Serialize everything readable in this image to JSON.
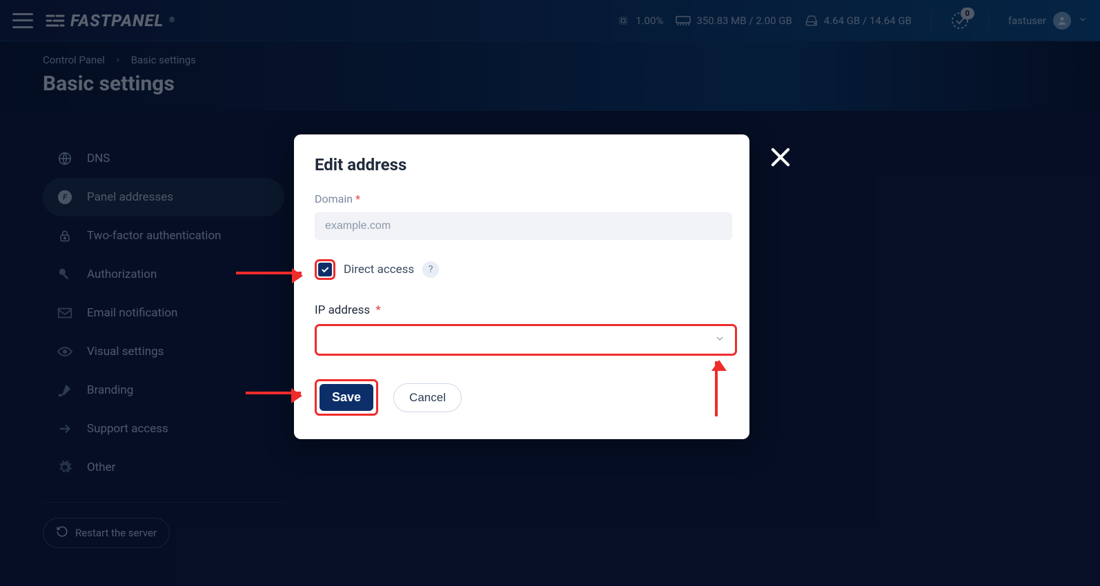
{
  "header": {
    "brand_text": "FASTPANEL",
    "cpu": "1.00%",
    "mem": "350.83 MB / 2.00 GB",
    "disk": "4.64 GB / 14.64 GB",
    "notif_badge": "0",
    "username": "fastuser"
  },
  "breadcrumb": {
    "root": "Control Panel",
    "current": "Basic settings"
  },
  "page": {
    "title": "Basic settings"
  },
  "sidemenu": {
    "items": [
      {
        "label": "DNS"
      },
      {
        "label": "Panel addresses"
      },
      {
        "label": "Two-factor authentication"
      },
      {
        "label": "Authorization"
      },
      {
        "label": "Email notification"
      },
      {
        "label": "Visual settings"
      },
      {
        "label": "Branding"
      },
      {
        "label": "Support access"
      },
      {
        "label": "Other"
      }
    ],
    "restart": "Restart the server"
  },
  "modal": {
    "title": "Edit address",
    "domain_label": "Domain",
    "domain_value": "example.com",
    "direct_access_label": "Direct access",
    "help": "?",
    "ip_label": "IP address",
    "save": "Save",
    "cancel": "Cancel"
  }
}
